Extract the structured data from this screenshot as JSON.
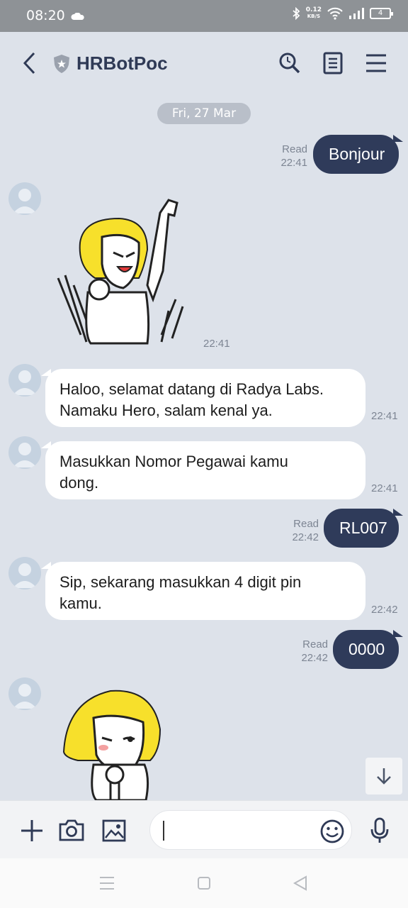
{
  "status": {
    "time": "08:20",
    "net_speed_value": "0.12",
    "net_speed_unit": "KB/S",
    "battery": "4"
  },
  "header": {
    "title": "HRBotPoc"
  },
  "date_separator": "Fri, 27 Mar",
  "messages": {
    "m1": {
      "text": "Bonjour",
      "read": "Read",
      "time": "22:41"
    },
    "m2": {
      "time": "22:41"
    },
    "m3": {
      "line1": "Haloo, selamat datang di Radya Labs.",
      "line2": "Namaku Hero, salam kenal ya.",
      "time": "22:41"
    },
    "m4": {
      "line1": "Masukkan Nomor Pegawai kamu",
      "line2": "dong.",
      "time": "22:41"
    },
    "m5": {
      "text": "RL007",
      "read": "Read",
      "time": "22:42"
    },
    "m6": {
      "line1": "Sip, sekarang masukkan 4 digit pin",
      "line2": "kamu.",
      "time": "22:42"
    },
    "m7": {
      "text": "0000",
      "read": "Read",
      "time": "22:42"
    }
  },
  "icons": {
    "back": "chevron-left-icon",
    "shield": "shield-icon",
    "search": "search-icon",
    "notes": "notes-icon",
    "menu": "hamburger-menu-icon",
    "plus": "plus-icon",
    "camera": "camera-icon",
    "image": "image-icon",
    "emoji": "emoji-icon",
    "mic": "microphone-icon",
    "scroll": "arrow-down-icon"
  },
  "colors": {
    "outgoing_bubble": "#2f3b5a",
    "incoming_bubble": "#ffffff",
    "background": "#dde2ea",
    "header_title": "#2f3a56"
  }
}
